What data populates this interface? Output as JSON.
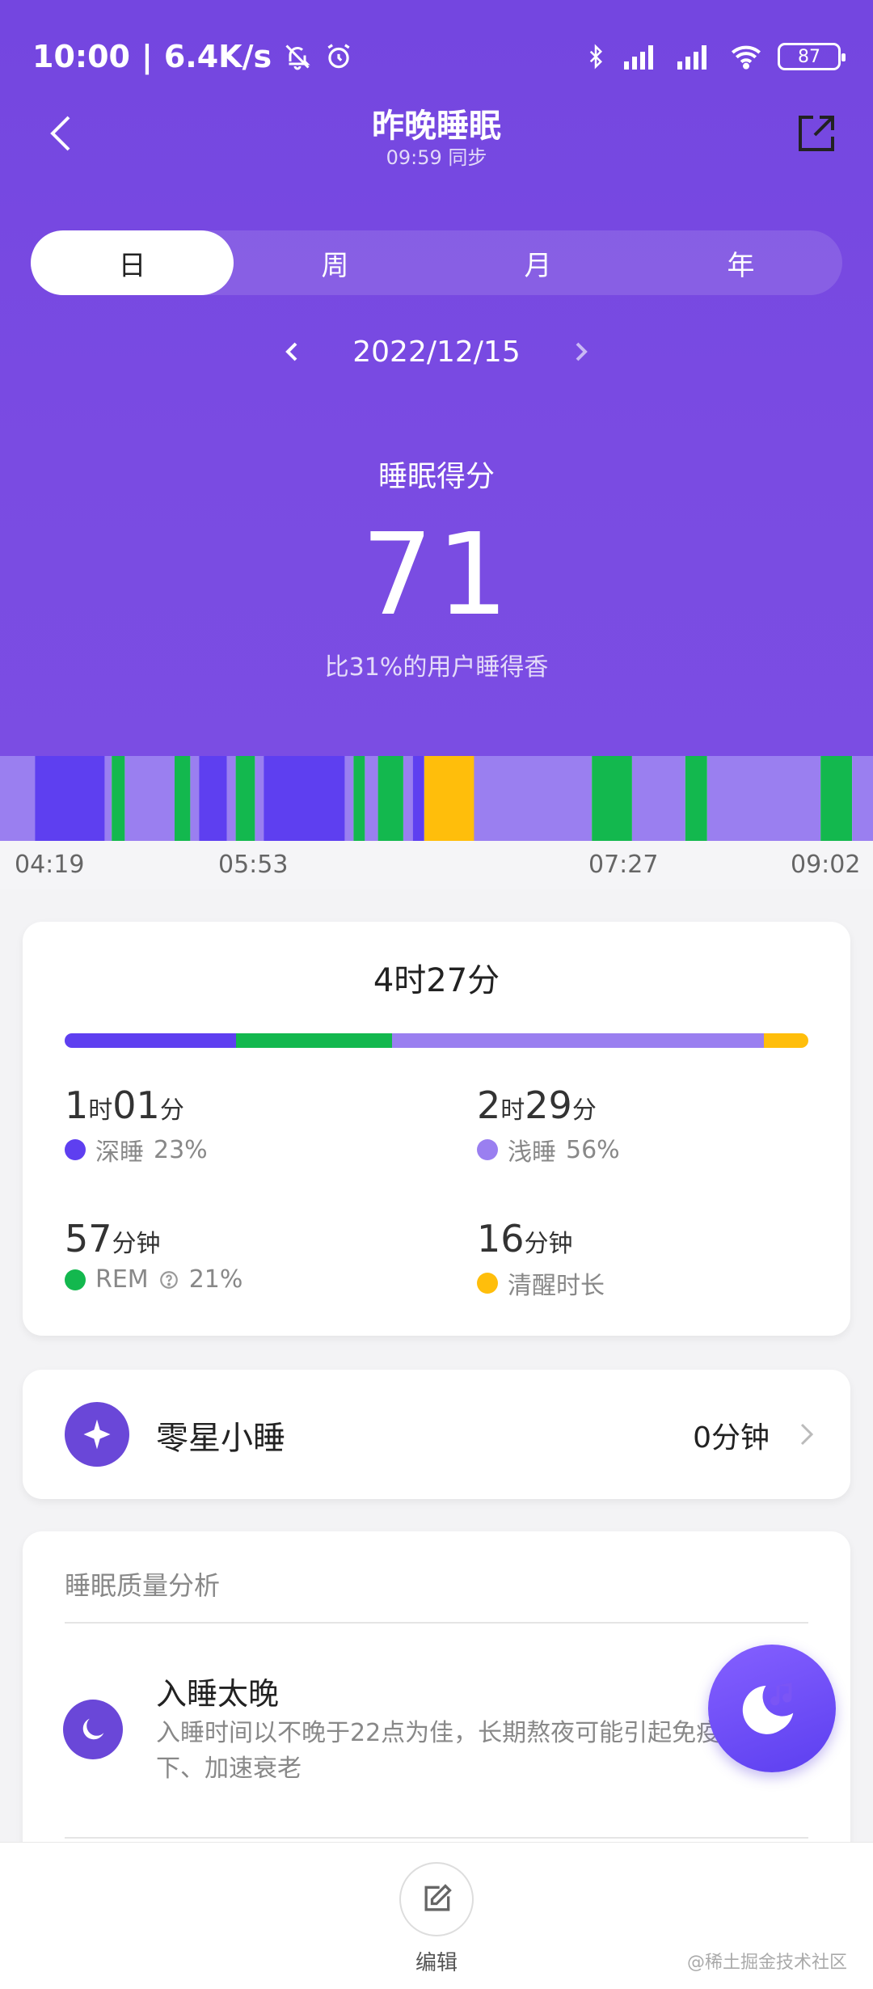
{
  "status_bar": {
    "time": "10:00",
    "separator": "|",
    "net_speed": "6.4K/s",
    "battery": "87"
  },
  "header": {
    "title": "昨晚睡眠",
    "sync": "09:59 同步"
  },
  "tabs": [
    {
      "label": "日",
      "active": true
    },
    {
      "label": "周",
      "active": false
    },
    {
      "label": "月",
      "active": false
    },
    {
      "label": "年",
      "active": false
    }
  ],
  "date": "2022/12/15",
  "score": {
    "label": "睡眠得分",
    "value": "71",
    "compare": "比31%的用户睡得香"
  },
  "timeline": {
    "labels": [
      "04:19",
      "05:53",
      "07:27",
      "09:02"
    ],
    "colors": {
      "deep": "#5e3ff0",
      "light": "#9a7ff0",
      "rem": "#13b84e",
      "awake": "#ffbe0b"
    },
    "segments": [
      {
        "stage": "light",
        "start": 0.0,
        "end": 0.04
      },
      {
        "stage": "deep",
        "start": 0.04,
        "end": 0.12
      },
      {
        "stage": "light",
        "start": 0.12,
        "end": 0.128
      },
      {
        "stage": "rem",
        "start": 0.128,
        "end": 0.143
      },
      {
        "stage": "light",
        "start": 0.143,
        "end": 0.2
      },
      {
        "stage": "rem",
        "start": 0.2,
        "end": 0.218
      },
      {
        "stage": "light",
        "start": 0.218,
        "end": 0.228
      },
      {
        "stage": "deep",
        "start": 0.228,
        "end": 0.26
      },
      {
        "stage": "light",
        "start": 0.26,
        "end": 0.27
      },
      {
        "stage": "rem",
        "start": 0.27,
        "end": 0.292
      },
      {
        "stage": "light",
        "start": 0.292,
        "end": 0.302
      },
      {
        "stage": "deep",
        "start": 0.302,
        "end": 0.395
      },
      {
        "stage": "light",
        "start": 0.395,
        "end": 0.405
      },
      {
        "stage": "rem",
        "start": 0.405,
        "end": 0.418
      },
      {
        "stage": "light",
        "start": 0.418,
        "end": 0.433
      },
      {
        "stage": "rem",
        "start": 0.433,
        "end": 0.462
      },
      {
        "stage": "light",
        "start": 0.462,
        "end": 0.473
      },
      {
        "stage": "deep",
        "start": 0.473,
        "end": 0.486
      },
      {
        "stage": "awake",
        "start": 0.486,
        "end": 0.543
      },
      {
        "stage": "light",
        "start": 0.543,
        "end": 0.678
      },
      {
        "stage": "rem",
        "start": 0.678,
        "end": 0.724
      },
      {
        "stage": "light",
        "start": 0.724,
        "end": 0.785
      },
      {
        "stage": "rem",
        "start": 0.785,
        "end": 0.81
      },
      {
        "stage": "light",
        "start": 0.81,
        "end": 0.94
      },
      {
        "stage": "rem",
        "start": 0.94,
        "end": 0.976
      },
      {
        "stage": "light",
        "start": 0.976,
        "end": 1.0
      }
    ]
  },
  "summary": {
    "total": "4时27分",
    "bar": [
      {
        "stage": "deep",
        "fraction": 0.23
      },
      {
        "stage": "rem",
        "fraction": 0.21
      },
      {
        "stage": "light",
        "fraction": 0.5
      },
      {
        "stage": "awake",
        "fraction": 0.06
      }
    ],
    "stats": [
      {
        "v1": "1",
        "u1": "时",
        "v2": "01",
        "u2": "分",
        "label": "深睡",
        "pct": "23%",
        "color": "#5e3ff0"
      },
      {
        "v1": "2",
        "u1": "时",
        "v2": "29",
        "u2": "分",
        "label": "浅睡",
        "pct": "56%",
        "color": "#9a7ff0"
      },
      {
        "v1": "57",
        "u1": "分钟",
        "v2": "",
        "u2": "",
        "label": "REM",
        "pct": "21%",
        "color": "#13b84e"
      },
      {
        "v1": "16",
        "u1": "分钟",
        "v2": "",
        "u2": "",
        "label": "清醒时长",
        "pct": "",
        "color": "#ffbe0b"
      }
    ]
  },
  "nap": {
    "title": "零星小睡",
    "value": "0分钟"
  },
  "quality": {
    "header": "睡眠质量分析",
    "item_title": "入睡太晚",
    "item_desc": "入睡时间以不晚于22点为佳，长期熬夜可能引起免疫力低下、加速衰老"
  },
  "bottom": {
    "edit_label": "编辑",
    "watermark": "@稀土掘金技术社区"
  }
}
